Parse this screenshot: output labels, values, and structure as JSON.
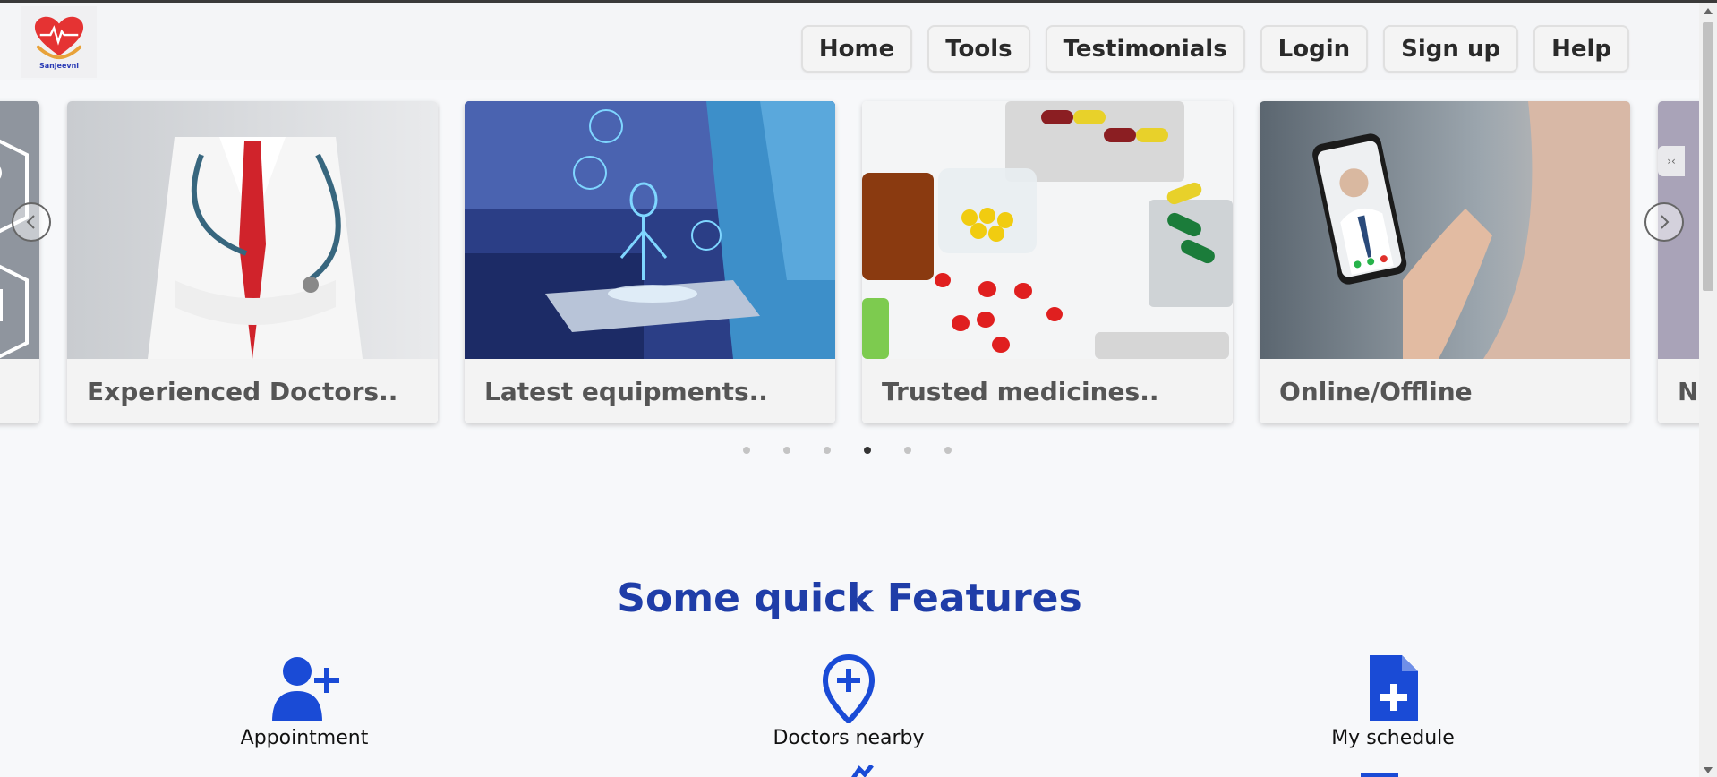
{
  "brand": {
    "name": "Sanjeevni"
  },
  "nav": {
    "items": [
      {
        "label": "Home"
      },
      {
        "label": "Tools"
      },
      {
        "label": "Testimonials"
      },
      {
        "label": "Login"
      },
      {
        "label": "Sign up"
      },
      {
        "label": "Help"
      }
    ]
  },
  "carousel": {
    "cards": [
      {
        "caption": "Experienced Doctors..",
        "image": "doctor-photo"
      },
      {
        "caption": "Latest equipments..",
        "image": "hologram-tablet-photo"
      },
      {
        "caption": "Trusted medicines..",
        "image": "pills-photo"
      },
      {
        "caption": "Online/Offline",
        "image": "video-call-phone-photo"
      },
      {
        "caption": "N",
        "image": "partial-card-photo"
      }
    ],
    "dots": 6,
    "active_dot": 4
  },
  "features": {
    "title": "Some quick Features",
    "items": [
      {
        "label": "Appointment",
        "icon": "user-plus-icon"
      },
      {
        "label": "Doctors nearby",
        "icon": "location-plus-icon"
      },
      {
        "label": "My schedule",
        "icon": "file-medical-icon"
      }
    ]
  },
  "colors": {
    "accent": "#1f3da8",
    "icon_blue": "#1a4bd6",
    "page_bg": "#f7f8fa"
  }
}
